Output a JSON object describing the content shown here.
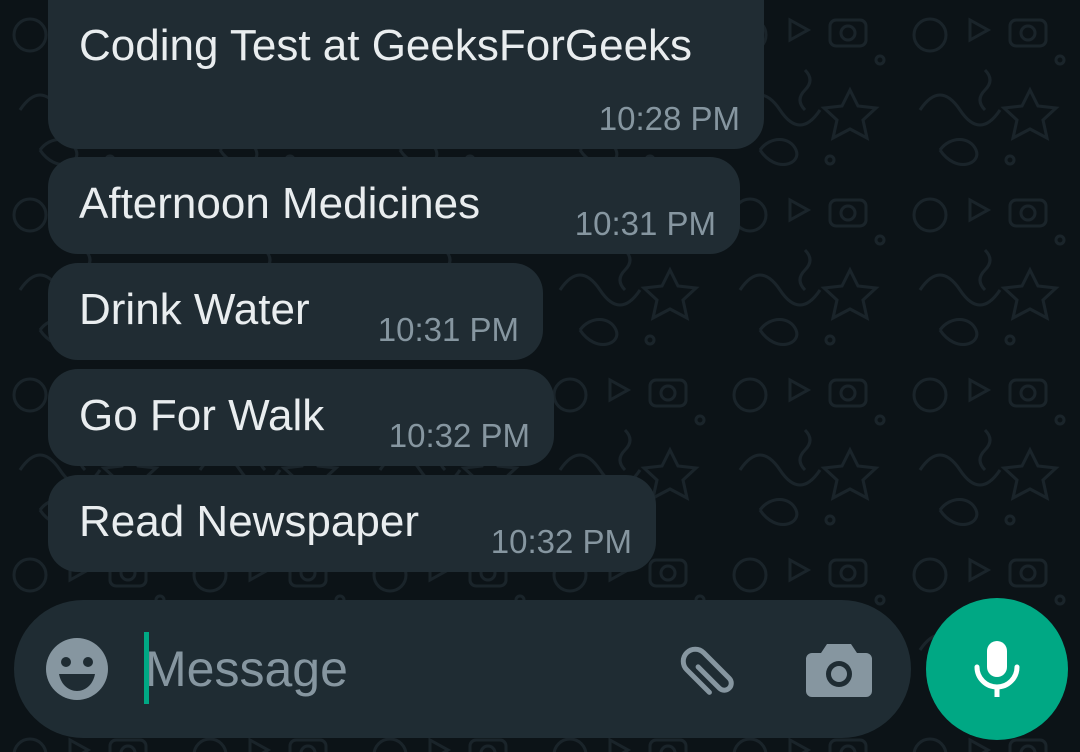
{
  "chat": {
    "messages": [
      {
        "text": "Coding Test at GeeksForGeeks",
        "time": "10:28 PM"
      },
      {
        "text": "Afternoon Medicines",
        "time": "10:31 PM"
      },
      {
        "text": "Drink Water",
        "time": "10:31 PM"
      },
      {
        "text": "Go For Walk",
        "time": "10:32 PM"
      },
      {
        "text": "Read Newspaper",
        "time": "10:32 PM"
      }
    ]
  },
  "composer": {
    "placeholder": "Message",
    "value": "",
    "icons": {
      "emoji": "emoji-icon",
      "attach": "paperclip-icon",
      "camera": "camera-icon",
      "mic": "microphone-icon"
    }
  },
  "colors": {
    "background": "#0c1317",
    "bubble": "#202c33",
    "text": "#e9edef",
    "time": "#8696a0",
    "composer": "#1f2c33",
    "accent": "#00a884",
    "icon": "#8696a0"
  }
}
